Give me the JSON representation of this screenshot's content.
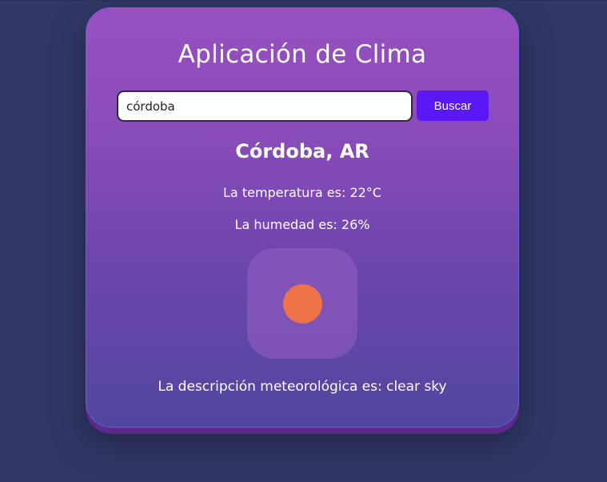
{
  "app": {
    "title": "Aplicación de Clima"
  },
  "search": {
    "value": "córdoba",
    "button_label": "Buscar"
  },
  "weather": {
    "city": "Córdoba, AR",
    "temperature_text": "La temperatura es: 22°C",
    "humidity_text": "La humedad es: 26%",
    "description_text": "La descripción meteorológica es: clear sky",
    "icon": "sun-icon",
    "sun_color": "#ee7349"
  },
  "colors": {
    "background": "#303865",
    "button": "#5b18f5",
    "card_top": "#9850c0",
    "card_bottom": "#51479f"
  }
}
